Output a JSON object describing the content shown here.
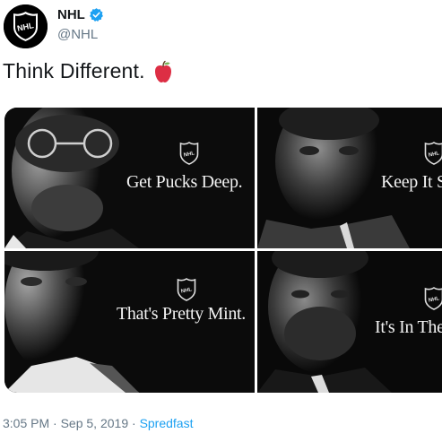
{
  "account": {
    "name": "NHL",
    "handle": "@NHL",
    "verified": true,
    "avatar_icon": "nhl-shield-logo"
  },
  "tweet": {
    "text": "Think Different.",
    "emoji_icon": "red-apple-icon"
  },
  "media": {
    "tiles": [
      {
        "caption": "Get Pucks Deep."
      },
      {
        "caption": "Keep It S"
      },
      {
        "caption": "That's Pretty Mint."
      },
      {
        "caption": "It's In The"
      }
    ]
  },
  "meta": {
    "time": "3:05 PM",
    "separator1": " · ",
    "date": "Sep 5, 2019",
    "separator2": " · ",
    "source": "Spredfast"
  },
  "colors": {
    "text": "#14171a",
    "muted": "#657786",
    "link": "#1da1f2",
    "apple": "#dd2e44"
  }
}
